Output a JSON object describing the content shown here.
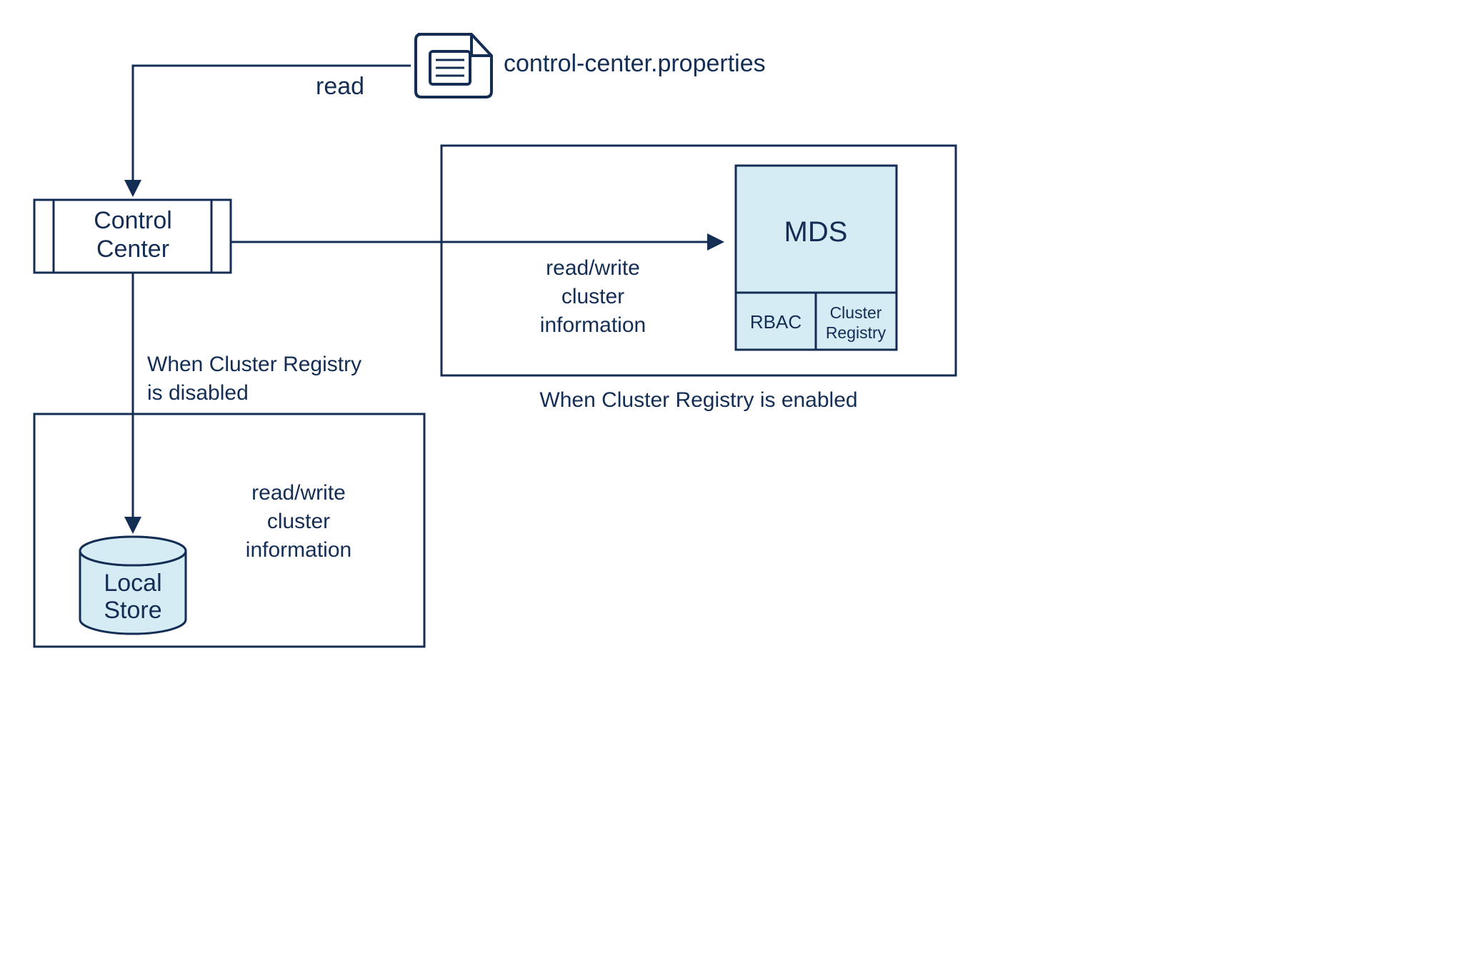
{
  "diagram": {
    "colors": {
      "stroke": "#142d54",
      "fill_light": "#d5ecf5",
      "background": "#ffffff"
    },
    "nodes": {
      "properties_file": {
        "label": "control-center.properties"
      },
      "control_center": {
        "label_line1": "Control",
        "label_line2": "Center"
      },
      "local_store": {
        "label_line1": "Local",
        "label_line2": "Store"
      },
      "mds": {
        "label": "MDS"
      },
      "rbac": {
        "label": "RBAC"
      },
      "cluster_registry": {
        "label_line1": "Cluster",
        "label_line2": "Registry"
      }
    },
    "edges": {
      "read_props": {
        "label": "read"
      },
      "to_mds": {
        "label_line1": "read/write",
        "label_line2": "cluster",
        "label_line3": "information"
      },
      "to_local": {
        "note_line1": "When Cluster Registry",
        "note_line2": "is disabled",
        "label_line1": "read/write",
        "label_line2": "cluster",
        "label_line3": "information"
      }
    },
    "captions": {
      "enabled": "When Cluster Registry is enabled"
    }
  }
}
